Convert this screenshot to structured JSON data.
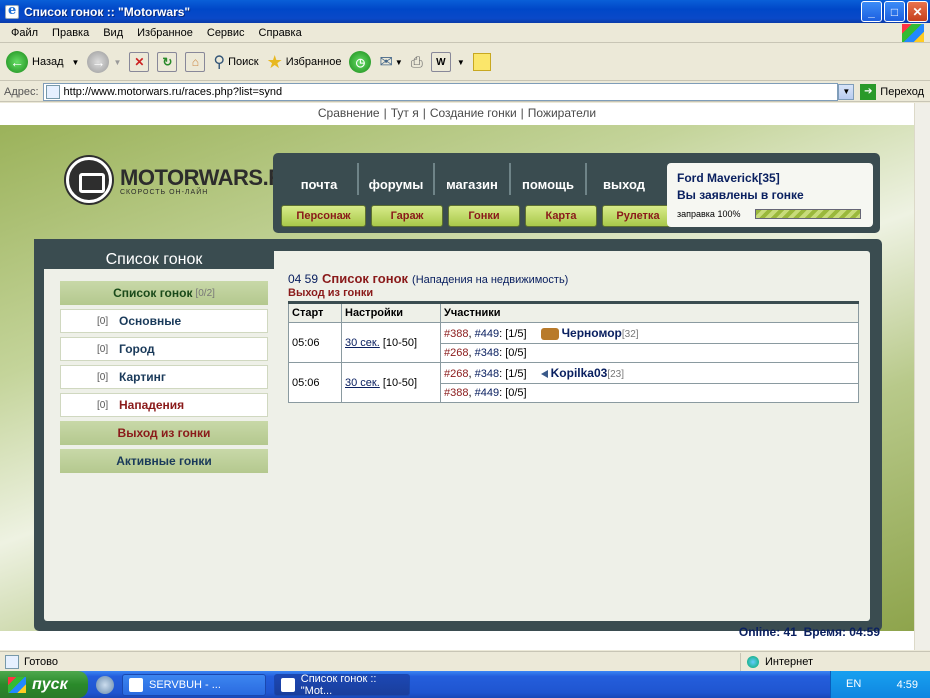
{
  "window": {
    "title": "Список гонок :: \"Motorwars\"",
    "minimize": "_",
    "maximize": "□",
    "close": "✕"
  },
  "menu": [
    "Файл",
    "Правка",
    "Вид",
    "Избранное",
    "Сервис",
    "Справка"
  ],
  "toolbar": {
    "back": "Назад",
    "search": "Поиск",
    "favorites": "Избранное"
  },
  "address": {
    "label": "Адрес:",
    "url": "http://www.motorwars.ru/races.php?list=synd",
    "go": "Переход"
  },
  "topnav": [
    "Сравнение",
    "Тут я",
    "Создание гонки",
    "Пожиратели"
  ],
  "logo": {
    "name": "MOTORWARS.RU",
    "slogan": "СКОРОСТЬ ОН-ЛАЙН"
  },
  "nav": {
    "tabs": [
      "почта",
      "форумы",
      "магазин",
      "помощь",
      "выход"
    ],
    "buttons": [
      "Персонаж",
      "Гараж",
      "Гонки",
      "Карта",
      "Рулетка"
    ]
  },
  "user": {
    "name": "Ford Maverick[35]",
    "status": "Вы заявлены в гонке",
    "fuel_label": "заправка 100%",
    "fuel_fraction": 1.0
  },
  "sidebar": {
    "title": "Список гонок",
    "items": [
      {
        "label": "Список гонок",
        "sub": "[0/2]"
      },
      {
        "count": "[0]",
        "label": "Основные"
      },
      {
        "count": "[0]",
        "label": "Город"
      },
      {
        "count": "[0]",
        "label": "Картинг"
      },
      {
        "count": "[0]",
        "label": "Нападения"
      },
      {
        "label": "Выход из гонки"
      },
      {
        "label": "Активные гонки"
      }
    ]
  },
  "main": {
    "time": "04 59",
    "title": "Список гонок",
    "note": "(Нападения на недвижимость)",
    "leave": "Выход из гонки",
    "columns": [
      "Старт",
      "Настройки",
      "Участники"
    ],
    "races": [
      {
        "start": "05:06",
        "settings_link": "30 сек.",
        "settings_range": "[10-50]",
        "rows": [
          {
            "slot_a": "#388",
            "slot_b": "#449",
            "count": ": [1/5]",
            "player": "Черномор",
            "level": "[32]"
          },
          {
            "slot_a": "#268",
            "slot_b": "#348",
            "count": ": [0/5]",
            "player": "",
            "level": ""
          }
        ]
      },
      {
        "start": "05:06",
        "settings_link": "30 сек.",
        "settings_range": "[10-50]",
        "rows": [
          {
            "slot_a": "#268",
            "slot_b": "#348",
            "count": ": [1/5]",
            "player": "Kopilka03",
            "level": "[23]"
          },
          {
            "slot_a": "#388",
            "slot_b": "#449",
            "count": ": [0/5]",
            "player": "",
            "level": ""
          }
        ]
      }
    ]
  },
  "footer": {
    "online": "Online: 41",
    "time": "Время: 04:59"
  },
  "status": {
    "text": "Готово",
    "zone": "Интернет"
  },
  "taskbar": {
    "start": "пуск",
    "task1": "SERVBUH - ...",
    "task2": "Список гонок :: \"Mot...",
    "lang": "EN",
    "clock": "4:59"
  },
  "colors": {
    "panel": "#3a4c50",
    "accent_red": "#8a1a1a",
    "accent_blue": "#0a2060",
    "button_green": "#a8c84a"
  }
}
